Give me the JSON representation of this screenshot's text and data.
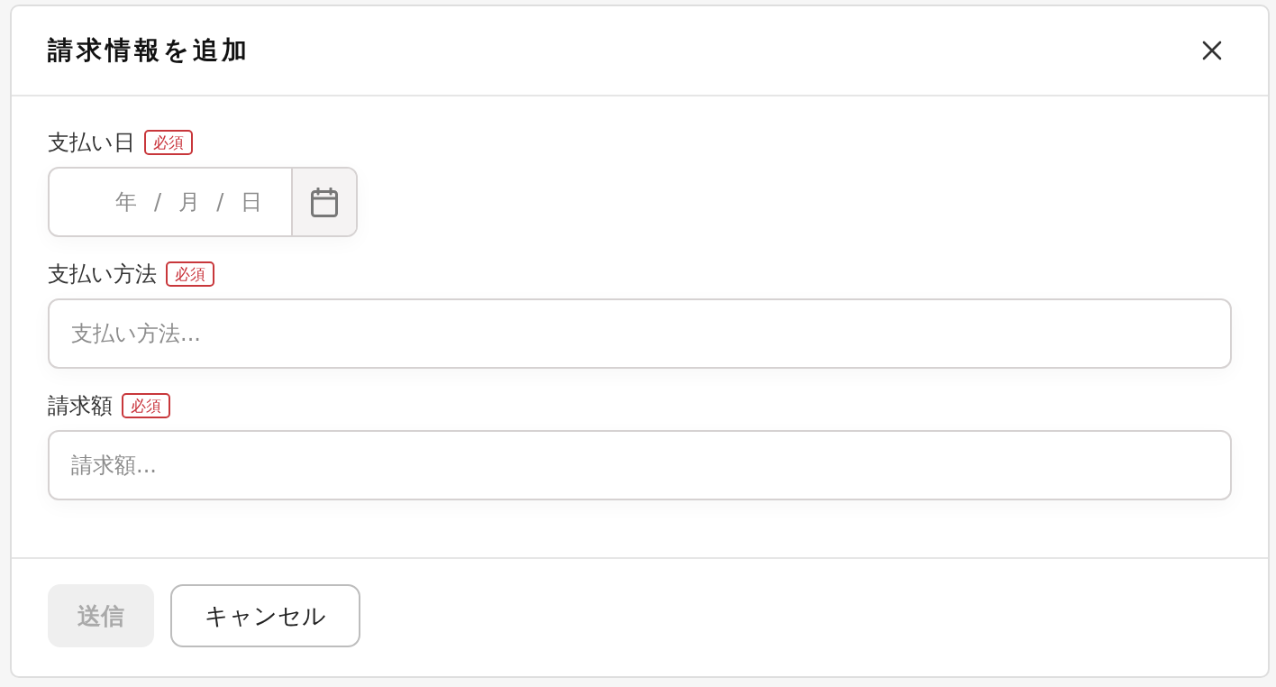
{
  "dialog": {
    "title": "請求情報を追加"
  },
  "fields": [
    {
      "kind": "date",
      "label": "支払い日",
      "badge": "必須",
      "placeholder": "年 / 月 / 日"
    },
    {
      "kind": "text",
      "label": "支払い方法",
      "badge": "必須",
      "placeholder": "支払い方法..."
    },
    {
      "kind": "text",
      "label": "請求額",
      "badge": "必須",
      "placeholder": "請求額..."
    }
  ],
  "buttons": [
    {
      "kind": "primary",
      "label": "送信",
      "disabled": true
    },
    {
      "kind": "secondary",
      "label": "キャンセル",
      "disabled": false
    }
  ]
}
